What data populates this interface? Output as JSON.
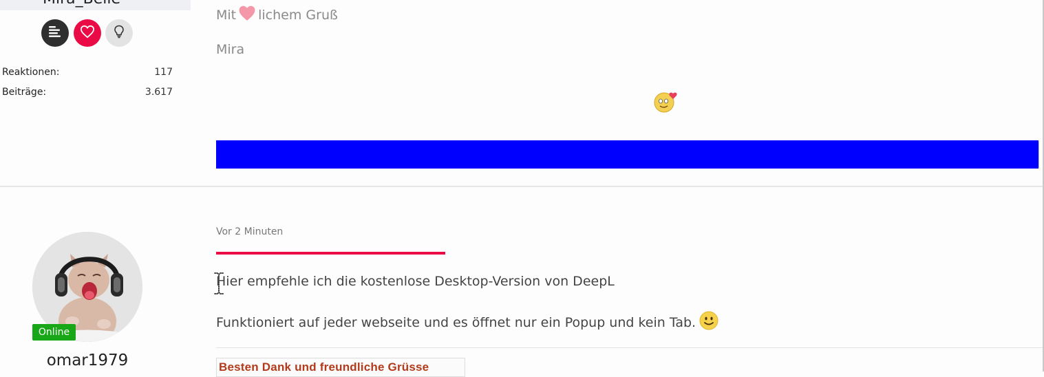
{
  "previous_post": {
    "username": "Mira_Belle",
    "stats": {
      "reactions_label": "Reaktionen:",
      "reactions_value": "117",
      "posts_label": "Beiträge:",
      "posts_value": "3.617"
    },
    "greeting_before": "Mit",
    "greeting_after": "lichem Gruß",
    "signature_name": "Mira"
  },
  "current_post": {
    "author": "omar1979",
    "status_badge": "Online",
    "time": "Vor 2 Minuten",
    "body": {
      "line1": "Hier empfehle ich die kostenlose Desktop-Version von DeepL",
      "line2": "Funktioniert auf jeder webseite und es öffnet nur ein Popup und kein Tab."
    },
    "signature": "Besten Dank und freundliche Grüsse"
  },
  "icons": {
    "posts": "list-icon",
    "likes": "heart-icon",
    "ideas": "lightbulb-icon",
    "heart_inline": "heart-icon",
    "hug_emoji": "hug-emoji-icon",
    "smile_emoji": "smile-emoji-icon",
    "cursor": "text-cursor-icon"
  },
  "colors": {
    "accent_red": "#ea0a45",
    "dark_button": "#2f2f2f",
    "light_button": "#e3e3e3",
    "banner_blue": "#0000ff",
    "online_green": "#17a717",
    "signature_text": "#b33a1b"
  }
}
